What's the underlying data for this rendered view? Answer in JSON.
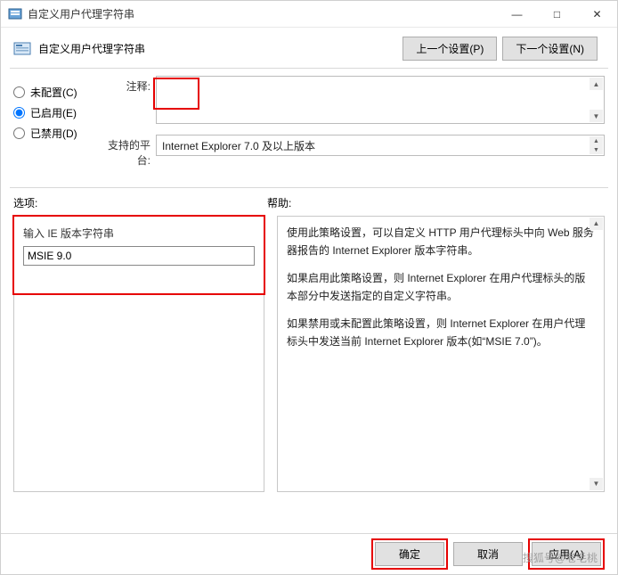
{
  "window": {
    "title": "自定义用户代理字符串"
  },
  "header": {
    "title": "自定义用户代理字符串",
    "prev": "上一个设置(P)",
    "next": "下一个设置(N)"
  },
  "radios": {
    "not_configured": "未配置(C)",
    "enabled": "已启用(E)",
    "disabled": "已禁用(D)",
    "selected": "enabled"
  },
  "fields": {
    "comment_label": "注释:",
    "comment_value": "",
    "platform_label": "支持的平台:",
    "platform_value": "Internet Explorer 7.0 及以上版本"
  },
  "options": {
    "section_label": "选项:",
    "input_label": "输入 IE 版本字符串",
    "input_value": "MSIE 9.0"
  },
  "help": {
    "section_label": "帮助:",
    "p1": "使用此策略设置，可以自定义 HTTP 用户代理标头中向 Web 服务器报告的 Internet Explorer 版本字符串。",
    "p2": "如果启用此策略设置，则 Internet Explorer 在用户代理标头的版本部分中发送指定的自定义字符串。",
    "p3": "如果禁用或未配置此策略设置，则 Internet Explorer 在用户代理标头中发送当前 Internet Explorer 版本(如“MSIE 7.0”)。"
  },
  "footer": {
    "ok": "确定",
    "cancel": "取消",
    "apply": "应用(A)"
  },
  "watermark": "搜狐号@老毛桃"
}
